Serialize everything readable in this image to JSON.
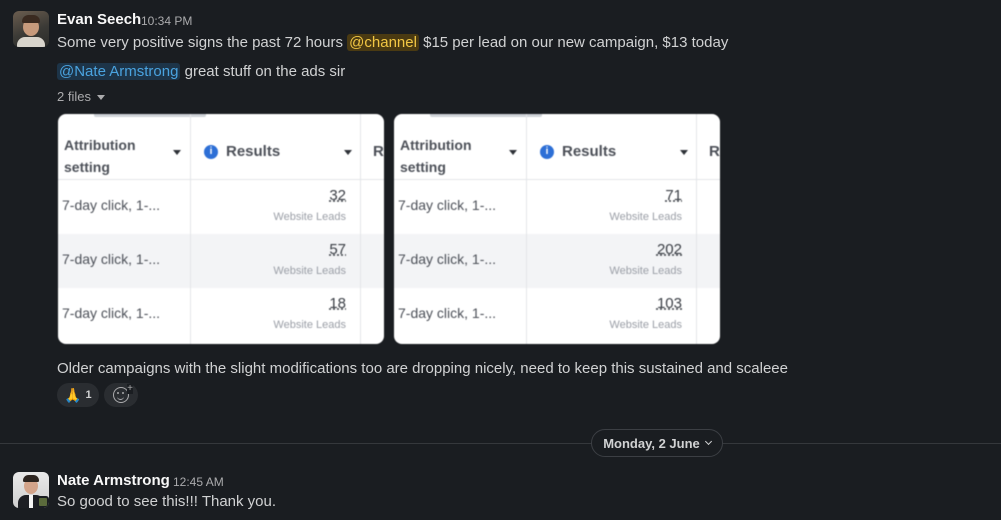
{
  "messages": [
    {
      "author": "Evan Seech",
      "time": "10:34 PM",
      "line1_pre": "Some very positive signs the past 72 hours ",
      "line1_mention": "@channel",
      "line1_post": " $15 per lead on our new campaign, $13 today",
      "line2_mention": "@Nate Armstrong",
      "line2_post": " great stuff on the ads sir",
      "files_label": "2 files",
      "attachments": [
        {
          "header_setting": "Attribution setting",
          "header_results": "Results",
          "header_next": "R",
          "rows": [
            {
              "setting": "7-day click, 1-...",
              "value": "32",
              "label": "Website Leads"
            },
            {
              "setting": "7-day click, 1-...",
              "value": "57",
              "label": "Website Leads"
            },
            {
              "setting": "7-day click, 1-...",
              "value": "18",
              "label": "Website Leads"
            }
          ]
        },
        {
          "header_setting": "Attribution setting",
          "header_results": "Results",
          "header_next": "R",
          "rows": [
            {
              "setting": "7-day click, 1-...",
              "value": "71",
              "label": "Website Leads"
            },
            {
              "setting": "7-day click, 1-...",
              "value": "202",
              "label": "Website Leads"
            },
            {
              "setting": "7-day click, 1-...",
              "value": "103",
              "label": "Website Leads"
            }
          ]
        }
      ],
      "line3": "Older campaigns with the slight modifications too are dropping nicely, need to keep this sustained and scaleee",
      "reaction": {
        "emoji": "🙏",
        "count": "1"
      },
      "add_reaction_icon": "add-reaction-icon"
    },
    {
      "author": "Nate Armstrong",
      "time": "12:45 AM",
      "text": "So good to see this!!! Thank you."
    }
  ],
  "date_divider": "Monday, 2 June",
  "colors": {
    "background": "#1a1d21",
    "channel_mention": "#f2c744",
    "user_mention": "#4aa3df"
  }
}
